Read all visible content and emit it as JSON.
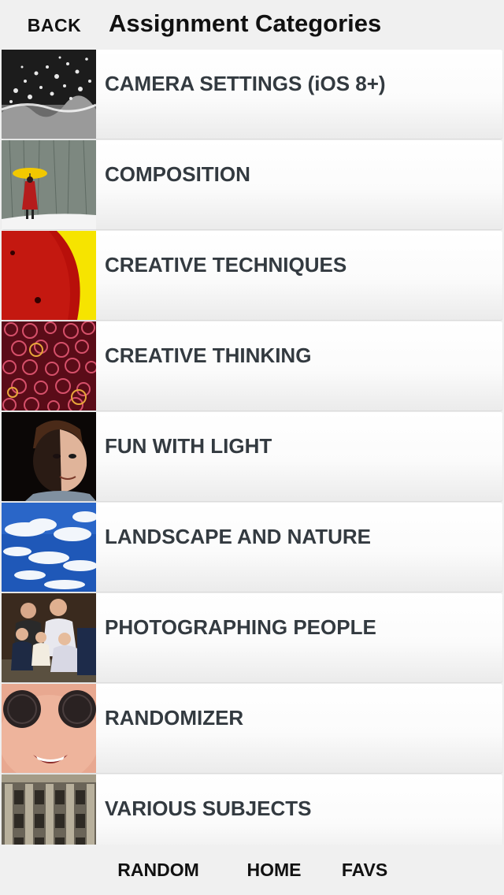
{
  "header": {
    "back_label": "BACK",
    "title": "Assignment Categories"
  },
  "categories": [
    {
      "label": "CAMERA SETTINGS (iOS 8+)",
      "thumbnail": "water-splash"
    },
    {
      "label": "COMPOSITION",
      "thumbnail": "yellow-umbrella-in-snow"
    },
    {
      "label": "CREATIVE TECHNIQUES",
      "thumbnail": "red-and-yellow-abstract"
    },
    {
      "label": "CREATIVE THINKING",
      "thumbnail": "red-bubbles-pattern"
    },
    {
      "label": "FUN WITH LIGHT",
      "thumbnail": "lit-face-portrait"
    },
    {
      "label": "LANDSCAPE AND NATURE",
      "thumbnail": "blue-sky-clouds"
    },
    {
      "label": "PHOTOGRAPHING PEOPLE",
      "thumbnail": "family-portrait"
    },
    {
      "label": "RANDOMIZER",
      "thumbnail": "cookie-eyes-face"
    },
    {
      "label": "VARIOUS SUBJECTS",
      "thumbnail": "building-facade"
    }
  ],
  "tabbar": {
    "random_label": "RANDOM",
    "home_label": "HOME",
    "favs_label": "FAVS"
  },
  "colors": {
    "background": "#f0f0f0",
    "row_label": "#333a40",
    "header_text": "#111111"
  }
}
